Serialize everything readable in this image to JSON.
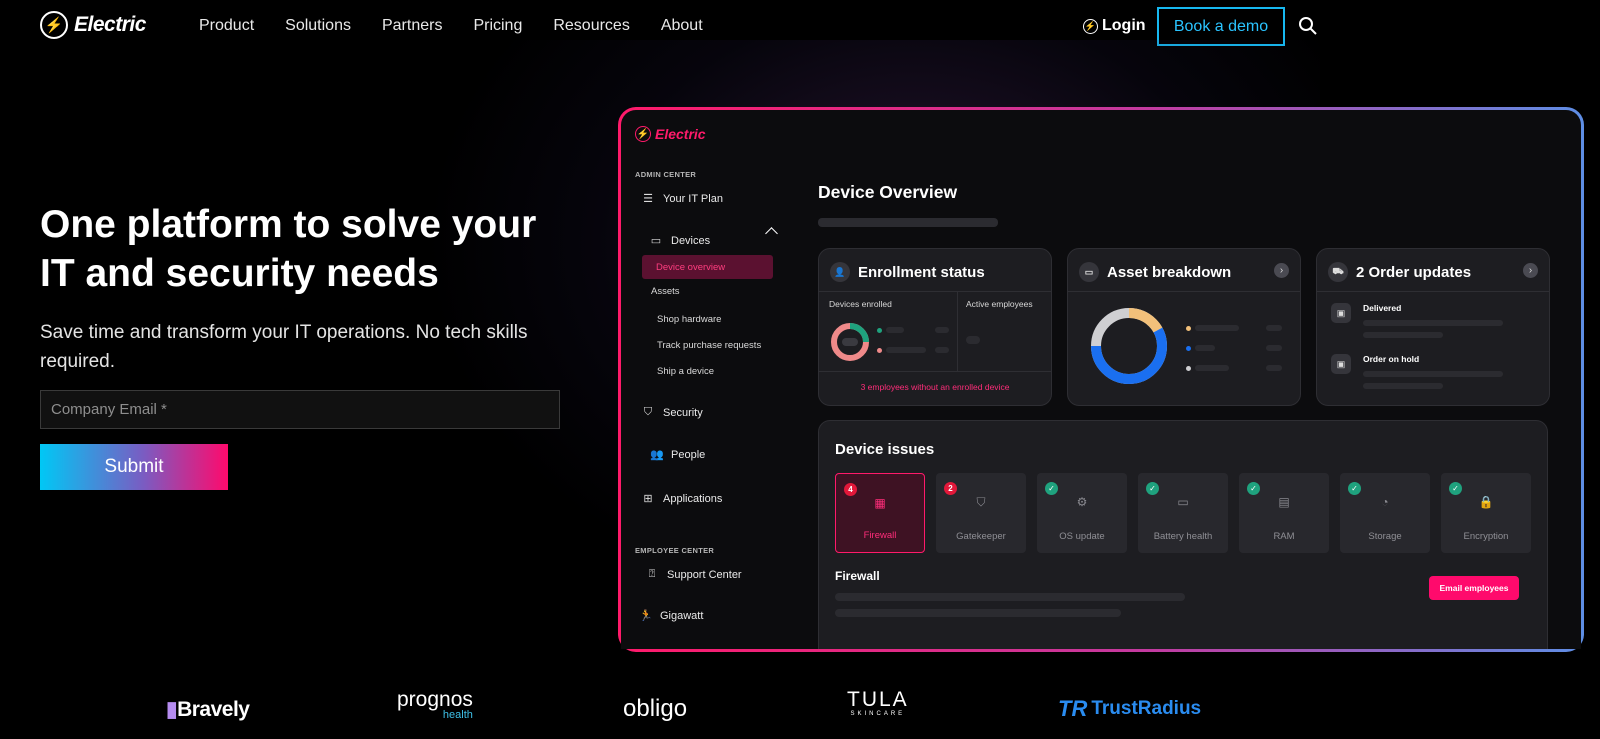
{
  "nav": {
    "brand": "Electric",
    "items": [
      "Product",
      "Solutions",
      "Partners",
      "Pricing",
      "Resources",
      "About"
    ],
    "login": "Login",
    "demo": "Book a demo"
  },
  "hero": {
    "title": "One platform to solve your IT and security needs",
    "subtitle": "Save time and transform your IT operations. No tech skills required.",
    "email_placeholder": "Company Email *",
    "submit": "Submit"
  },
  "dashboard": {
    "brand": "Electric",
    "admin_center": "ADMIN CENTER",
    "employee_center": "EMPLOYEE CENTER",
    "sidebar": {
      "it_plan": "Your IT Plan",
      "devices": "Devices",
      "device_overview": "Device overview",
      "assets": "Assets",
      "shop_hardware": "Shop hardware",
      "track_purchase": "Track purchase requests",
      "ship_device": "Ship a device",
      "security": "Security",
      "people": "People",
      "applications": "Applications",
      "support_center": "Support Center",
      "gigawatt": "Gigawatt"
    },
    "title": "Device Overview",
    "enrollment": {
      "title": "Enrollment status",
      "devices_enrolled": "Devices enrolled",
      "active_employees": "Active employees",
      "warning": "3 employees without an enrolled device"
    },
    "assets": {
      "title": "Asset breakdown"
    },
    "orders": {
      "title": "2 Order updates",
      "delivered": "Delivered",
      "on_hold": "Order on hold"
    },
    "issues": {
      "title": "Device issues",
      "tiles": [
        {
          "label": "Firewall",
          "badge": "4"
        },
        {
          "label": "Gatekeeper",
          "badge": "2"
        },
        {
          "label": "OS update"
        },
        {
          "label": "Battery health"
        },
        {
          "label": "RAM"
        },
        {
          "label": "Storage"
        },
        {
          "label": "Encryption"
        }
      ],
      "selected": "Firewall",
      "email_button": "Email employees"
    }
  },
  "logos": {
    "bravely": "Bravely",
    "prognos": "prognos",
    "prognos_sub": "health",
    "obligo": "obligo",
    "tula": "TULA",
    "tula_sub": "SKINCARE",
    "trustradius": "TrustRadius"
  },
  "colors": {
    "accent": "#ff0a6c",
    "cyan": "#17b8f0"
  }
}
